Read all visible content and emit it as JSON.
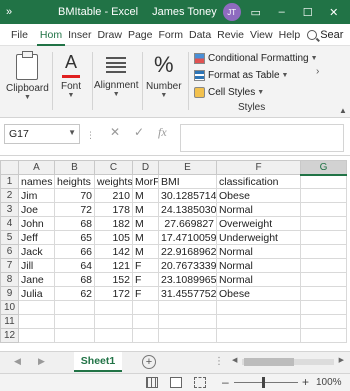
{
  "titlebar": {
    "app_title": "BMItable - Excel",
    "user_name": "James Toney",
    "user_initials": "JT",
    "restore_label": "▭",
    "minimize_label": "–",
    "maximize_label": "☐",
    "close_label": "✕",
    "chevron": "»"
  },
  "tabs": {
    "file": "File",
    "items": [
      "Hom",
      "Inser",
      "Draw",
      "Page",
      "Form",
      "Data",
      "Revie",
      "View",
      "Help"
    ],
    "search": "Sear",
    "more": "»"
  },
  "ribbon": {
    "clipboard": "Clipboard",
    "font": "Font",
    "alignment": "Alignment",
    "number": "Number",
    "number_symbol": "%",
    "conditional_formatting": "Conditional Formatting",
    "format_as_table": "Format as Table",
    "cell_styles": "Cell Styles",
    "styles_group": "Styles"
  },
  "formula_bar": {
    "name_box": "G17",
    "fx": "fx",
    "value": ""
  },
  "grid": {
    "columns": [
      "A",
      "B",
      "C",
      "D",
      "E",
      "F",
      "G"
    ],
    "selected_column": "G",
    "rows": [
      [
        "names",
        "heights",
        "weights",
        "MorF",
        "BMI",
        "classification",
        ""
      ],
      [
        "Jim",
        "70",
        "210",
        "M",
        "30.12857143",
        "Obese",
        ""
      ],
      [
        "Joe",
        "72",
        "178",
        "M",
        "24.13850309",
        "Normal",
        ""
      ],
      [
        "John",
        "68",
        "182",
        "M",
        "27.669827",
        "Overweight",
        ""
      ],
      [
        "Jeff",
        "65",
        "105",
        "M",
        "17.47100592",
        "Underweight",
        ""
      ],
      [
        "Jack",
        "66",
        "142",
        "M",
        "22.91689624",
        "Normal",
        ""
      ],
      [
        "Jill",
        "64",
        "121",
        "F",
        "20.76733398",
        "Normal",
        ""
      ],
      [
        "Jane",
        "68",
        "152",
        "F",
        "23.10899654",
        "Normal",
        ""
      ],
      [
        "Julia",
        "62",
        "172",
        "F",
        "31.45577523",
        "Obese",
        ""
      ],
      [
        "",
        "",
        "",
        "",
        "",
        "",
        ""
      ],
      [
        "",
        "",
        "",
        "",
        "",
        "",
        ""
      ],
      [
        "",
        "",
        "",
        "",
        "",
        "",
        ""
      ]
    ]
  },
  "sheets": {
    "active": "Sheet1",
    "add_label": "+"
  },
  "status": {
    "zoom": "100%"
  }
}
